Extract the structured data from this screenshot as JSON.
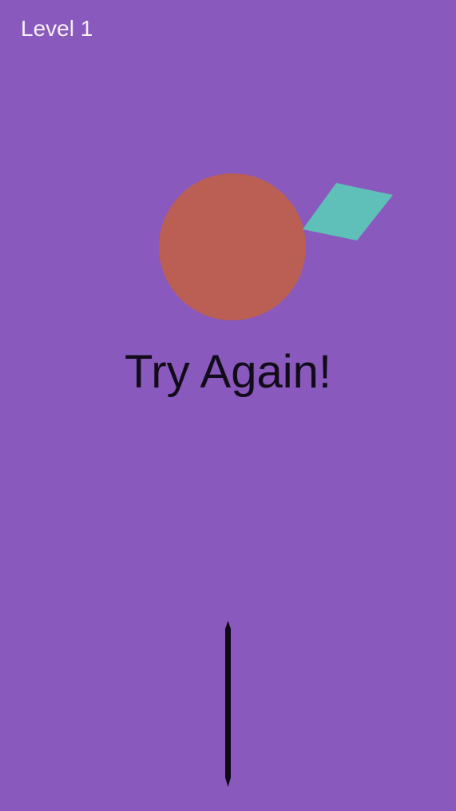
{
  "hud": {
    "level_label": "Level 1"
  },
  "message": {
    "text": "Try Again!"
  },
  "colors": {
    "background": "#8a59bd",
    "ball": "#bb5f55",
    "slab": "#5fbfb9",
    "needle": "#0d0a12",
    "level_text": "#f5f0fa",
    "message_text": "#120c1a"
  },
  "objects": {
    "ball": "circle",
    "slab": "rotated-rhombus",
    "needle": "vertical-stick"
  }
}
